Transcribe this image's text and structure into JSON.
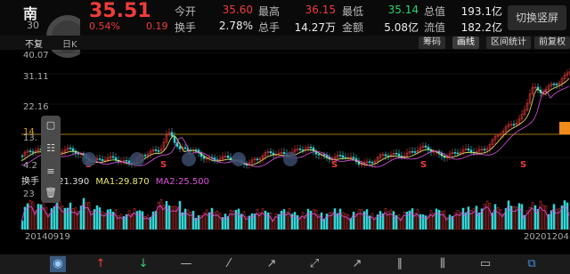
{
  "header": {
    "name": "南",
    "code": "30",
    "price": "35.51",
    "change_pct": "0.54%",
    "change": "0.19",
    "stats_row1": [
      {
        "label": "今开",
        "value": "35.60",
        "color": "red"
      },
      {
        "label": "最高",
        "value": "36.15",
        "color": "red"
      },
      {
        "label": "最低",
        "value": "35.14",
        "color": "green"
      },
      {
        "label": "总值",
        "value": "193.1亿",
        "color": "white"
      }
    ],
    "stats_row2": [
      {
        "label": "换手",
        "value": "2.78%",
        "color": "white"
      },
      {
        "label": "总手",
        "value": "14.27万",
        "color": "white"
      },
      {
        "label": "金额",
        "value": "5.08亿",
        "color": "white"
      },
      {
        "label": "流值",
        "value": "182.2亿",
        "color": "white"
      }
    ],
    "switch_label": "切换竖屏"
  },
  "toolbar": {
    "left_label_a": "不复",
    "left_label_b": "日K",
    "buttons": [
      {
        "label": "筹码",
        "active": false
      },
      {
        "label": "画线",
        "active": true
      },
      {
        "label": "区间统计",
        "active": false
      },
      {
        "label": "前复权",
        "active": false
      }
    ]
  },
  "chart": {
    "y_ticks": [
      "40.07",
      "31.11",
      "22.16",
      "14",
      "13.",
      "4.2"
    ],
    "ref_line_value": "14",
    "s_marker": "S",
    "colors": {
      "up": "#f03c3c",
      "down": "#2fd6d6",
      "ma1": "#e8e870",
      "ma2": "#e050e0",
      "ref": "#d8a020"
    }
  },
  "ma": {
    "label_prefix": "换手",
    "ma_val": "21.390",
    "ma1": "MA1:29.870",
    "ma2": "MA2:25.500"
  },
  "volume": {
    "y_tick": "23"
  },
  "dates": {
    "start": "20140919",
    "end": "20201204"
  },
  "bottom_icons": [
    "eye-icon",
    "up-arrow-icon",
    "down-arrow-icon",
    "line-icon",
    "diagonal-icon",
    "ray-icon",
    "cross-icon",
    "arrow-icon",
    "parallel-icon",
    "channel-icon",
    "rect-icon",
    "expand-icon"
  ]
}
